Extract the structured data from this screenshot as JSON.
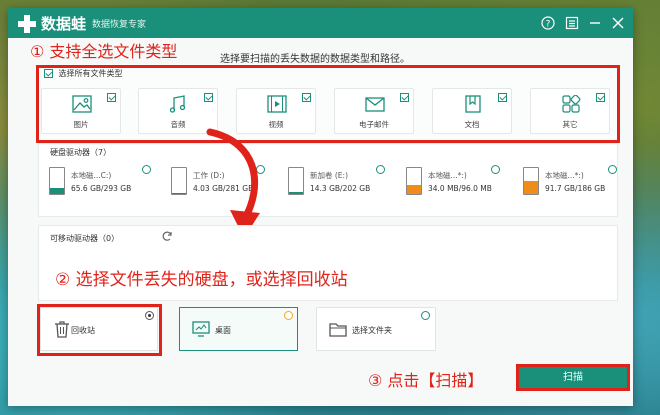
{
  "app": {
    "name": "数据蛙",
    "subtitle": "数据恢复专家"
  },
  "titlebar_icons": {
    "help": "help-icon",
    "menu": "menu-icon",
    "minimize": "minimize-icon",
    "close": "close-icon"
  },
  "annotations": {
    "step1": "① 支持全选文件类型",
    "step2": "② 选择文件丢失的硬盘，或选择回收站",
    "step3": "③ 点击【扫描】"
  },
  "instruction": "选择要扫描的丢失数据的数据类型和路径。",
  "file_types": {
    "select_all_label": "选择所有文件类型",
    "items": [
      {
        "label": "图片",
        "icon": "image-icon",
        "checked": true
      },
      {
        "label": "音频",
        "icon": "audio-icon",
        "checked": true
      },
      {
        "label": "视频",
        "icon": "video-icon",
        "checked": true
      },
      {
        "label": "电子邮件",
        "icon": "email-icon",
        "checked": true
      },
      {
        "label": "文档",
        "icon": "document-icon",
        "checked": true
      },
      {
        "label": "其它",
        "icon": "other-icon",
        "checked": true
      }
    ]
  },
  "hard_drives": {
    "label": "硬盘驱动器（7）",
    "items": [
      {
        "name": "本地磁...C:)",
        "size": "65.6 GB/293 GB",
        "fill": 0.22,
        "fill_color": "#1a8f7a"
      },
      {
        "name": "工作 (D:)",
        "size": "4.03 GB/281 GB",
        "fill": 0.02,
        "fill_color": "#1a8f7a"
      },
      {
        "name": "新加卷 (E:)",
        "size": "14.3 GB/202 GB",
        "fill": 0.07,
        "fill_color": "#1a8f7a"
      },
      {
        "name": "本地磁...*:)",
        "size": "34.0 MB/96.0 MB",
        "fill": 0.35,
        "fill_color": "#f08c1a"
      },
      {
        "name": "本地磁...*:)",
        "size": "91.7 GB/186 GB",
        "fill": 0.49,
        "fill_color": "#f08c1a"
      }
    ]
  },
  "removable_drives": {
    "label": "可移动驱动器（0）"
  },
  "locations": [
    {
      "label": "回收站",
      "icon": "recycle-bin-icon",
      "selected": true
    },
    {
      "label": "桌面",
      "icon": "desktop-icon",
      "selected": false
    },
    {
      "label": "选择文件夹",
      "icon": "folder-icon",
      "selected": false
    }
  ],
  "scan_button": "扫描",
  "colors": {
    "brand": "#1a8f7a",
    "annotation_red": "#e0231a",
    "radio_orange": "#f5a623"
  }
}
